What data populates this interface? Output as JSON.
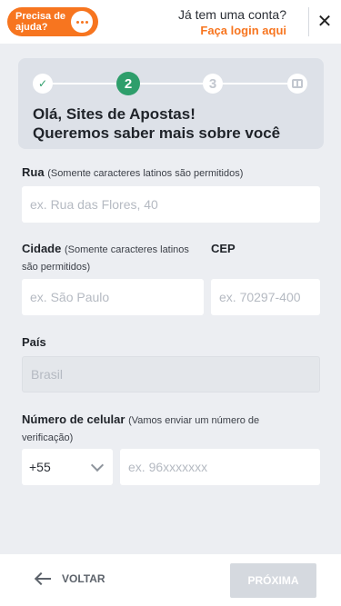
{
  "header": {
    "help_label": "Precisa de ajuda?",
    "account_question": "Já tem uma conta?",
    "login_link": "Faça login aqui",
    "close_icon": "close-icon",
    "chat_icon": "chat-bubble-icon"
  },
  "progress": {
    "steps": [
      {
        "label": "✓",
        "state": "done"
      },
      {
        "label": "2",
        "state": "active"
      },
      {
        "label": "3",
        "state": "inactive"
      },
      {
        "label": "",
        "state": "gift",
        "icon": "gift-icon"
      }
    ],
    "greeting_line1": "Olá, Sites de Apostas!",
    "greeting_line2": "Queremos saber mais sobre você"
  },
  "form": {
    "street": {
      "label": "Rua",
      "hint": "(Somente caracteres latinos são permitidos)",
      "placeholder": "ex. Rua das Flores, 40",
      "value": ""
    },
    "city": {
      "label": "Cidade",
      "hint": "(Somente caracteres latinos são permitidos)",
      "placeholder": "ex. São Paulo",
      "value": ""
    },
    "zip": {
      "label": "CEP",
      "placeholder": "ex. 70297-400",
      "value": ""
    },
    "country": {
      "label": "País",
      "value": "Brasil"
    },
    "phone": {
      "label": "Número de celular",
      "hint": "(Vamos enviar um número de verificação)",
      "code": "+55",
      "placeholder": "ex. 96xxxxxxx",
      "value": ""
    }
  },
  "footer": {
    "back_label": "VOLTAR",
    "next_label": "PRÓXIMA"
  },
  "colors": {
    "accent": "#f7751f",
    "step_active": "#2e9e6b",
    "background": "#eceef2"
  }
}
